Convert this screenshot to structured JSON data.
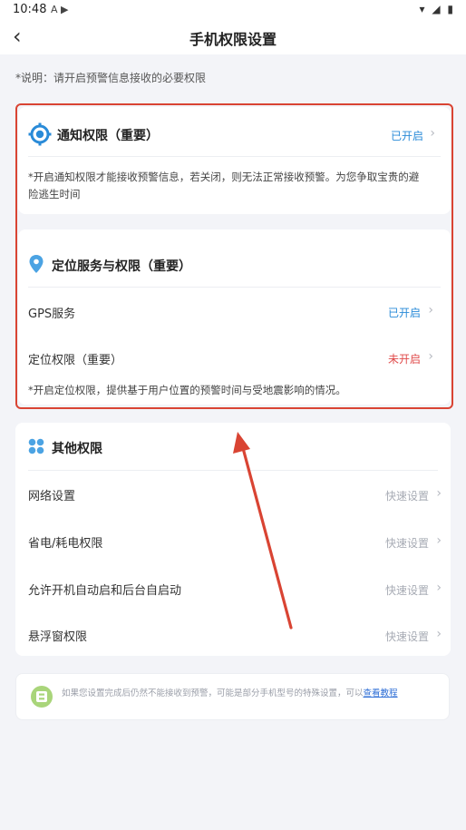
{
  "status_bar": {
    "time": "10:48",
    "left_icons": "A ▶",
    "right_icons": "▾ ◢ ▮"
  },
  "header": {
    "back_glyph": "‹",
    "title": "手机权限设置"
  },
  "note": "*说明：请开启预警信息接收的必要权限",
  "notification": {
    "title": "通知权限（重要）",
    "status": "已开启",
    "description_line1": "*开启通知权限才能接收预警信息，若关闭，则无法正常接收预警。为您争取宝贵的避",
    "description_line2": "险逃生时间"
  },
  "location": {
    "title": "定位服务与权限（重要）",
    "rows": [
      {
        "label": "GPS服务",
        "status": "已开启"
      },
      {
        "label": "定位权限（重要）",
        "status": "未开启"
      }
    ],
    "description": "*开启定位权限，提供基于用户位置的预警时间与受地震影响的情况。"
  },
  "other": {
    "title": "其他权限",
    "rows": [
      {
        "label": "网络设置",
        "action": "快速设置"
      },
      {
        "label": "省电/耗电权限",
        "action": "快速设置"
      },
      {
        "label": "允许开机自动启和后台自启动",
        "action": "快速设置"
      },
      {
        "label": "悬浮窗权限",
        "action": "快速设置"
      }
    ]
  },
  "footer_notice": {
    "text": "如果您设置完成后仍然不能接收到预警，可能是部分手机型号的特殊设置，可以",
    "link": "查看教程"
  },
  "colors": {
    "enabled": "#2a8bd8",
    "disabled": "#e04a4a",
    "muted": "#a7abb4",
    "annotation": "#d94433",
    "notification_icon": "#2a8bd8",
    "location_icon": "#4ba3e3",
    "other_icon": "#4ba3e3",
    "notice_icon": "#8cc34a"
  },
  "icons": {
    "notification": "target-icon",
    "location": "location-pin-icon",
    "other": "four-dots-icon",
    "chevron": "chevron-right-icon",
    "notice": "letter-b-badge-icon"
  }
}
